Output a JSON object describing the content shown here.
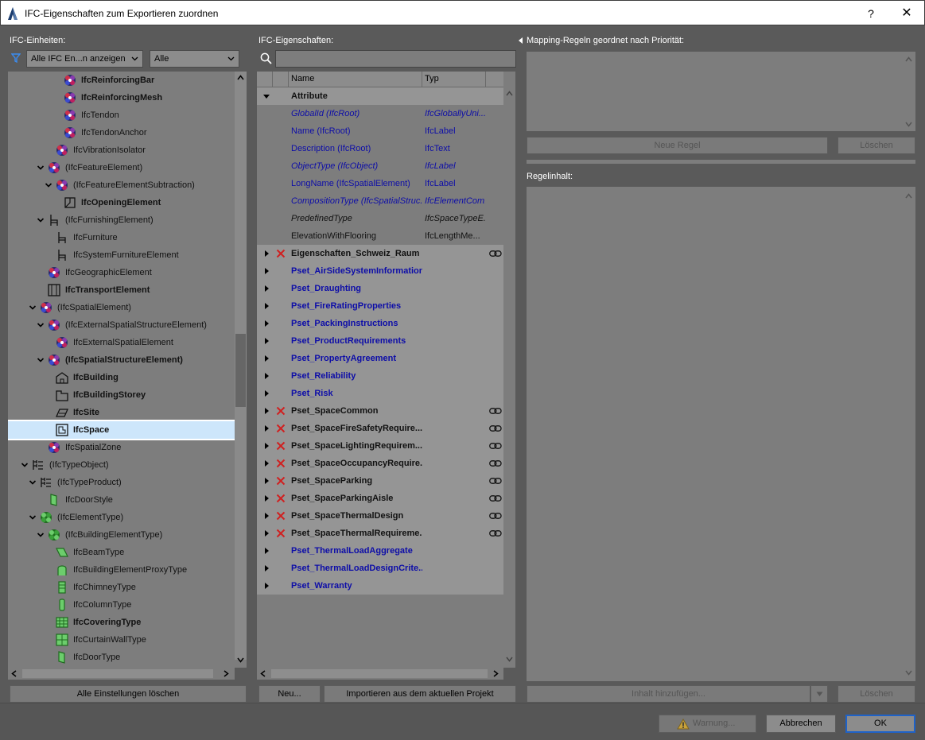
{
  "window": {
    "title": "IFC-Eigenschaften zum Exportieren zuordnen",
    "help": "?",
    "close": "✕"
  },
  "left": {
    "label": "IFC-Einheiten:",
    "filter_select": "Alle IFC En...n anzeigen",
    "scope_select": "Alle",
    "tree": [
      {
        "label": "IfcReinforcingBar",
        "indent": 4,
        "bold": true,
        "twisty": "",
        "icon": "multi-color-element-icon"
      },
      {
        "label": "IfcReinforcingMesh",
        "indent": 4,
        "bold": true,
        "twisty": "",
        "icon": "multi-color-element-icon"
      },
      {
        "label": "IfcTendon",
        "indent": 4,
        "bold": false,
        "twisty": "",
        "icon": "multi-color-element-icon"
      },
      {
        "label": "IfcTendonAnchor",
        "indent": 4,
        "bold": false,
        "twisty": "",
        "icon": "multi-color-element-icon"
      },
      {
        "label": "IfcVibrationIsolator",
        "indent": 3,
        "bold": false,
        "twisty": "",
        "icon": "multi-color-element-icon"
      },
      {
        "label": "(IfcFeatureElement)",
        "indent": 2,
        "bold": false,
        "twisty": "open",
        "icon": "multi-color-element-icon"
      },
      {
        "label": "(IfcFeatureElementSubtraction)",
        "indent": 3,
        "bold": false,
        "twisty": "open",
        "icon": "multi-color-element-icon"
      },
      {
        "label": "IfcOpeningElement",
        "indent": 4,
        "bold": true,
        "twisty": "",
        "icon": "opening-icon"
      },
      {
        "label": "(IfcFurnishingElement)",
        "indent": 2,
        "bold": false,
        "twisty": "open",
        "icon": "chair-icon"
      },
      {
        "label": "IfcFurniture",
        "indent": 3,
        "bold": false,
        "twisty": "",
        "icon": "chair-icon"
      },
      {
        "label": "IfcSystemFurnitureElement",
        "indent": 3,
        "bold": false,
        "twisty": "",
        "icon": "chair-icon"
      },
      {
        "label": "IfcGeographicElement",
        "indent": 2,
        "bold": false,
        "twisty": "",
        "icon": "multi-color-element-icon"
      },
      {
        "label": "IfcTransportElement",
        "indent": 2,
        "bold": true,
        "twisty": "",
        "icon": "elevator-icon"
      },
      {
        "label": "(IfcSpatialElement)",
        "indent": 1,
        "bold": false,
        "twisty": "open",
        "icon": "multi-color-element-icon"
      },
      {
        "label": "(IfcExternalSpatialStructureElement)",
        "indent": 2,
        "bold": false,
        "twisty": "open",
        "icon": "multi-color-element-icon"
      },
      {
        "label": "IfcExternalSpatialElement",
        "indent": 3,
        "bold": false,
        "twisty": "",
        "icon": "multi-color-element-icon"
      },
      {
        "label": "(IfcSpatialStructureElement)",
        "indent": 2,
        "bold": true,
        "twisty": "open",
        "icon": "multi-color-element-icon"
      },
      {
        "label": "IfcBuilding",
        "indent": 3,
        "bold": true,
        "twisty": "",
        "icon": "building-icon"
      },
      {
        "label": "IfcBuildingStorey",
        "indent": 3,
        "bold": true,
        "twisty": "",
        "icon": "storey-icon"
      },
      {
        "label": "IfcSite",
        "indent": 3,
        "bold": true,
        "twisty": "",
        "icon": "site-icon"
      },
      {
        "label": "IfcSpace",
        "indent": 3,
        "bold": true,
        "twisty": "",
        "icon": "space-icon",
        "selected": true
      },
      {
        "label": "IfcSpatialZone",
        "indent": 2,
        "bold": false,
        "twisty": "",
        "icon": "multi-color-element-icon"
      },
      {
        "label": "(IfcTypeObject)",
        "indent": 0,
        "bold": false,
        "twisty": "open",
        "icon": "type-tree-icon"
      },
      {
        "label": "(IfcTypeProduct)",
        "indent": 1,
        "bold": false,
        "twisty": "open",
        "icon": "type-tree-icon"
      },
      {
        "label": "IfcDoorStyle",
        "indent": 2,
        "bold": false,
        "twisty": "",
        "icon": "green-door-icon"
      },
      {
        "label": "(IfcElementType)",
        "indent": 1,
        "bold": false,
        "twisty": "open",
        "icon": "green-element-icon"
      },
      {
        "label": "(IfcBuildingElementType)",
        "indent": 2,
        "bold": false,
        "twisty": "open",
        "icon": "green-element-icon"
      },
      {
        "label": "IfcBeamType",
        "indent": 3,
        "bold": false,
        "twisty": "",
        "icon": "green-beam-icon"
      },
      {
        "label": "IfcBuildingElementProxyType",
        "indent": 3,
        "bold": false,
        "twisty": "",
        "icon": "green-proxy-icon"
      },
      {
        "label": "IfcChimneyType",
        "indent": 3,
        "bold": false,
        "twisty": "",
        "icon": "green-chimney-icon"
      },
      {
        "label": "IfcColumnType",
        "indent": 3,
        "bold": false,
        "twisty": "",
        "icon": "green-column-icon"
      },
      {
        "label": "IfcCoveringType",
        "indent": 3,
        "bold": true,
        "twisty": "",
        "icon": "green-covering-icon"
      },
      {
        "label": "IfcCurtainWallType",
        "indent": 3,
        "bold": false,
        "twisty": "",
        "icon": "green-curtainwall-icon"
      },
      {
        "label": "IfcDoorType",
        "indent": 3,
        "bold": false,
        "twisty": "",
        "icon": "green-door-icon"
      }
    ],
    "clear_all_button": "Alle Einstellungen löschen"
  },
  "middle": {
    "label": "IFC-Eigenschaften:",
    "search_value": "",
    "col_name": "Name",
    "col_type": "Typ",
    "rows": [
      {
        "kind": "group-open",
        "name": "Attribute",
        "typ": "",
        "style": "bold dark"
      },
      {
        "kind": "attr",
        "name": "GlobalId (IfcRoot)",
        "typ": "IfcGloballyUni...",
        "style": "blue ital"
      },
      {
        "kind": "attr",
        "name": "Name (IfcRoot)",
        "typ": "IfcLabel",
        "style": "blue"
      },
      {
        "kind": "attr",
        "name": "Description (IfcRoot)",
        "typ": "IfcText",
        "style": "blue"
      },
      {
        "kind": "attr",
        "name": "ObjectType (IfcObject)",
        "typ": "IfcLabel",
        "style": "blue ital"
      },
      {
        "kind": "attr",
        "name": "LongName (IfcSpatialElement)",
        "typ": "IfcLabel",
        "style": "blue"
      },
      {
        "kind": "attr",
        "name": "CompositionType (IfcSpatialStruc...",
        "typ": "IfcElementCom...",
        "style": "blue ital"
      },
      {
        "kind": "attr",
        "name": "PredefinedType",
        "typ": "IfcSpaceTypeE...",
        "style": "dark ital"
      },
      {
        "kind": "attr",
        "name": "ElevationWithFlooring",
        "typ": "IfcLengthMe...",
        "style": "dark"
      },
      {
        "kind": "pset",
        "name": "Eigenschaften_Schweiz_Raum",
        "typ": "",
        "style": "bold dark",
        "x": true,
        "link": true
      },
      {
        "kind": "pset",
        "name": "Pset_AirSideSystemInformation",
        "typ": "",
        "style": "bold blue"
      },
      {
        "kind": "pset",
        "name": "Pset_Draughting",
        "typ": "",
        "style": "bold blue"
      },
      {
        "kind": "pset",
        "name": "Pset_FireRatingProperties",
        "typ": "",
        "style": "bold blue"
      },
      {
        "kind": "pset",
        "name": "Pset_PackingInstructions",
        "typ": "",
        "style": "bold blue"
      },
      {
        "kind": "pset",
        "name": "Pset_ProductRequirements",
        "typ": "",
        "style": "bold blue"
      },
      {
        "kind": "pset",
        "name": "Pset_PropertyAgreement",
        "typ": "",
        "style": "bold blue"
      },
      {
        "kind": "pset",
        "name": "Pset_Reliability",
        "typ": "",
        "style": "bold blue"
      },
      {
        "kind": "pset",
        "name": "Pset_Risk",
        "typ": "",
        "style": "bold blue"
      },
      {
        "kind": "pset",
        "name": "Pset_SpaceCommon",
        "typ": "",
        "style": "bold dark",
        "x": true,
        "link": true
      },
      {
        "kind": "pset",
        "name": "Pset_SpaceFireSafetyRequire...",
        "typ": "",
        "style": "bold dark",
        "x": true,
        "link": true
      },
      {
        "kind": "pset",
        "name": "Pset_SpaceLightingRequirem...",
        "typ": "",
        "style": "bold dark",
        "x": true,
        "link": true
      },
      {
        "kind": "pset",
        "name": "Pset_SpaceOccupancyRequire...",
        "typ": "",
        "style": "bold dark",
        "x": true,
        "link": true
      },
      {
        "kind": "pset",
        "name": "Pset_SpaceParking",
        "typ": "",
        "style": "bold dark",
        "x": true,
        "link": true
      },
      {
        "kind": "pset",
        "name": "Pset_SpaceParkingAisle",
        "typ": "",
        "style": "bold dark",
        "x": true,
        "link": true
      },
      {
        "kind": "pset",
        "name": "Pset_SpaceThermalDesign",
        "typ": "",
        "style": "bold dark",
        "x": true,
        "link": true
      },
      {
        "kind": "pset",
        "name": "Pset_SpaceThermalRequireme...",
        "typ": "",
        "style": "bold dark",
        "x": true,
        "link": true
      },
      {
        "kind": "pset",
        "name": "Pset_ThermalLoadAggregate",
        "typ": "",
        "style": "bold blue"
      },
      {
        "kind": "pset",
        "name": "Pset_ThermalLoadDesignCrite...",
        "typ": "",
        "style": "bold blue"
      },
      {
        "kind": "pset",
        "name": "Pset_Warranty",
        "typ": "",
        "style": "bold blue"
      }
    ],
    "new_button": "Neu...",
    "import_button": "Importieren aus dem aktuellen Projekt"
  },
  "right": {
    "rules_label": "Mapping-Regeln geordnet nach Priorität:",
    "new_rule_button": "Neue Regel",
    "delete_rule_button": "Löschen",
    "content_label": "Regelinhalt:",
    "add_content_button": "Inhalt hinzufügen...",
    "delete_content_button": "Löschen"
  },
  "footer": {
    "warning_button": "Warnung...",
    "cancel_button": "Abbrechen",
    "ok_button": "OK"
  },
  "colors": {
    "dialog_bg": "#5a5a5a",
    "panel_bg": "#7d7d7d",
    "selection": "#cde6fb",
    "link_blue": "#0d0da8",
    "accent_blue": "#1e62c8",
    "error_red": "#d02020"
  }
}
